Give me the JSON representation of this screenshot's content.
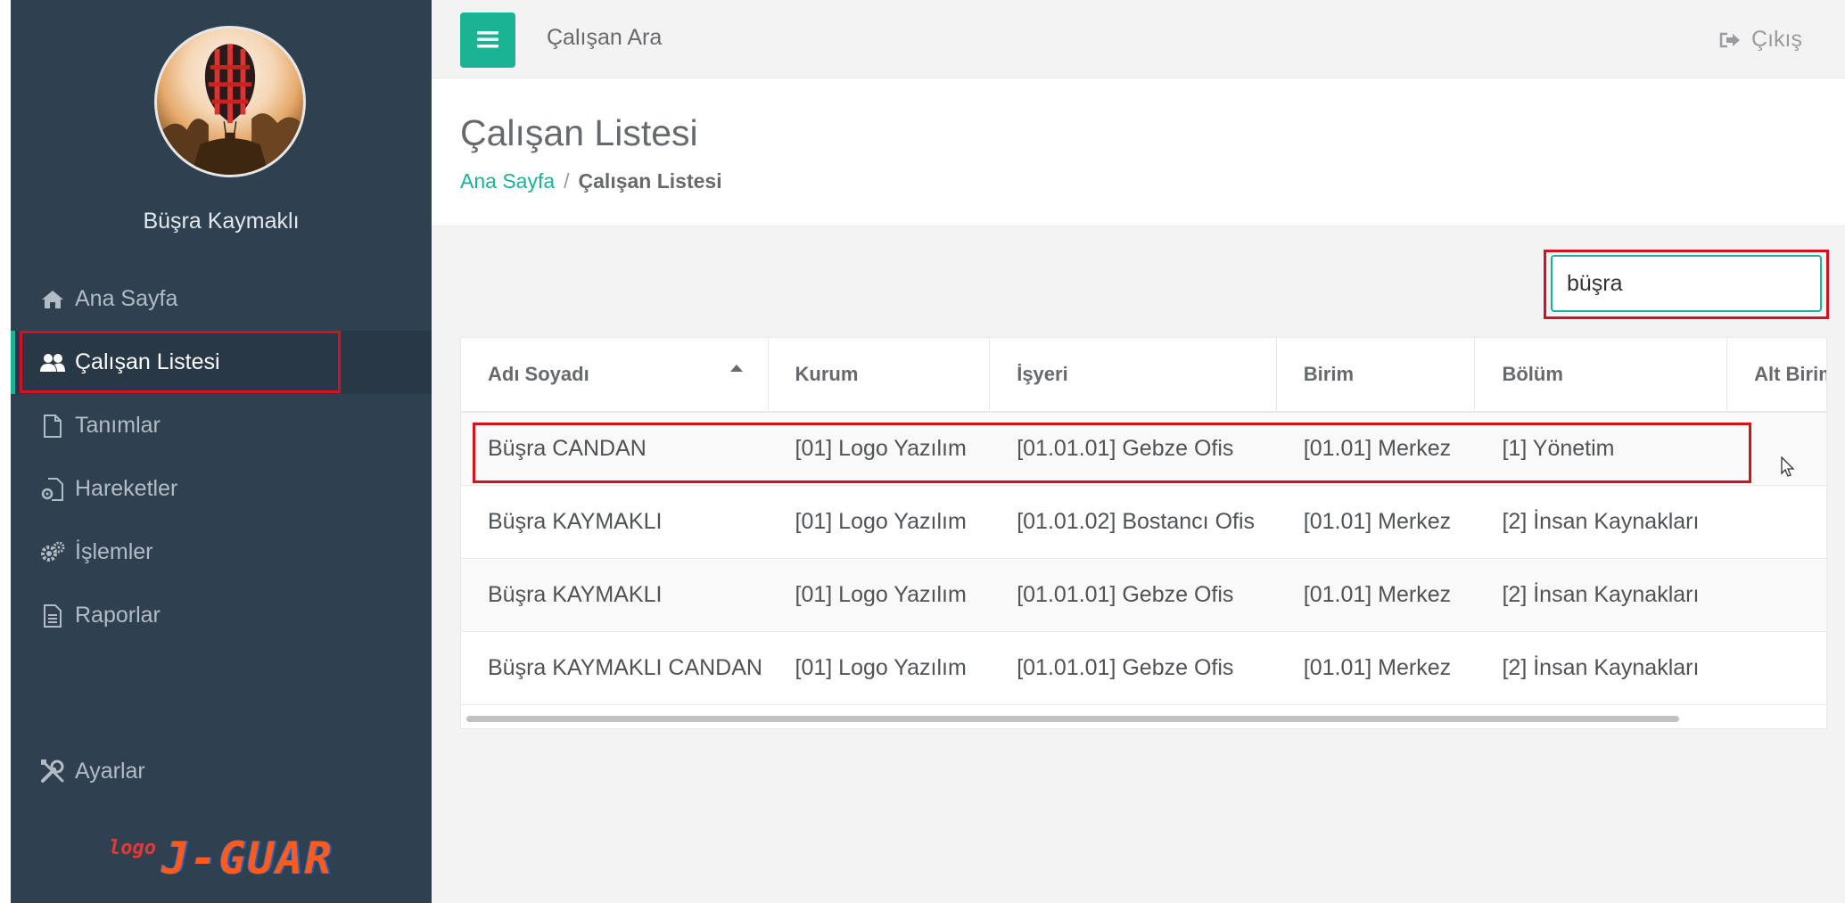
{
  "sidebar": {
    "user_name": "Büşra Kaymaklı",
    "nav": [
      {
        "label": "Ana Sayfa",
        "icon": "home-icon",
        "active": false
      },
      {
        "label": "Çalışan Listesi",
        "icon": "users-icon",
        "active": true
      },
      {
        "label": "Tanımlar",
        "icon": "file-icon",
        "active": false
      },
      {
        "label": "Hareketler",
        "icon": "file-gear-icon",
        "active": false
      },
      {
        "label": "İşlemler",
        "icon": "gears-icon",
        "active": false
      },
      {
        "label": "Raporlar",
        "icon": "report-icon",
        "active": false
      }
    ],
    "settings_label": "Ayarlar",
    "logo": {
      "small": "logo",
      "big": "J-GUAR"
    }
  },
  "topbar": {
    "title": "Çalışan Ara",
    "logout_label": "Çıkış"
  },
  "page": {
    "title": "Çalışan Listesi",
    "breadcrumb": {
      "home": "Ana Sayfa",
      "sep": "/",
      "current": "Çalışan Listesi"
    }
  },
  "search": {
    "value": "büşra"
  },
  "table": {
    "columns": [
      "Adı Soyadı",
      "Kurum",
      "İşyeri",
      "Birim",
      "Bölüm",
      "Alt Birim"
    ],
    "rows": [
      [
        "Büşra CANDAN",
        "[01] Logo Yazılım",
        "[01.01.01] Gebze Ofis",
        "[01.01] Merkez",
        "[1] Yönetim",
        ""
      ],
      [
        "Büşra KAYMAKLI",
        "[01] Logo Yazılım",
        "[01.01.02] Bostancı Ofis",
        "[01.01] Merkez",
        "[2] İnsan Kaynakları",
        ""
      ],
      [
        "Büşra KAYMAKLI",
        "[01] Logo Yazılım",
        "[01.01.01] Gebze Ofis",
        "[01.01] Merkez",
        "[2] İnsan Kaynakları",
        ""
      ],
      [
        "Büşra KAYMAKLI CANDAN",
        "[01] Logo Yazılım",
        "[01.01.01] Gebze Ofis",
        "[01.01] Merkez",
        "[2] İnsan Kaynakları",
        ""
      ]
    ]
  },
  "colors": {
    "accent": "#1ab394",
    "sidebar": "#2f4050",
    "highlight": "#d6111e"
  }
}
